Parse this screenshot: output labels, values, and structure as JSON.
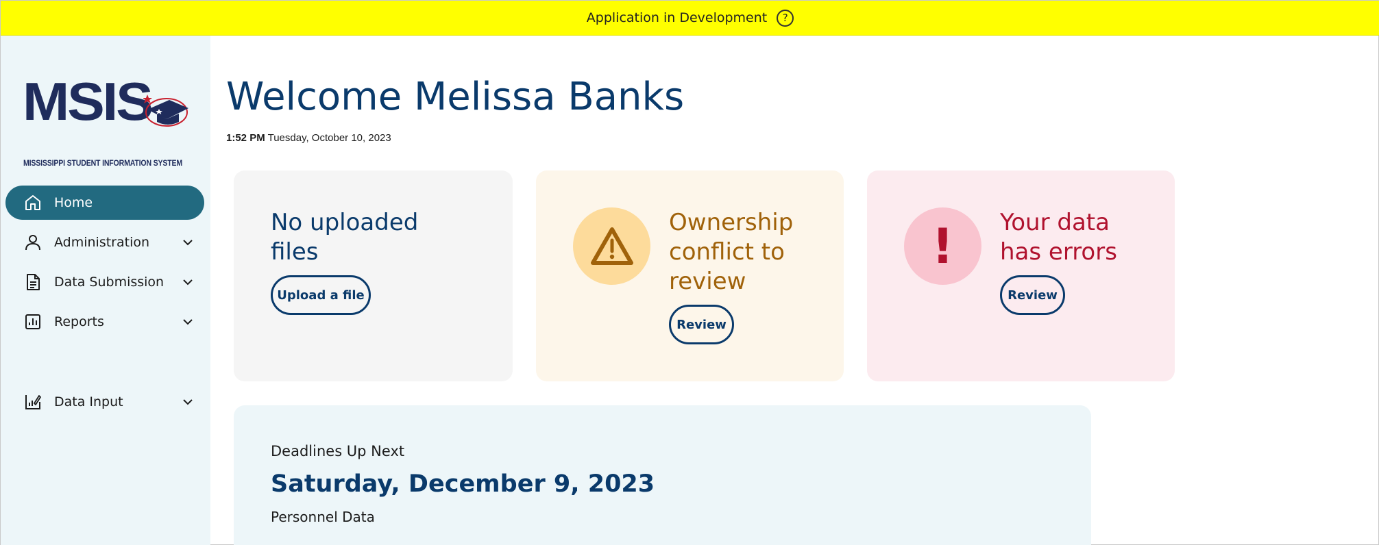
{
  "banner": {
    "text": "Application in Development",
    "help_icon": "help-circle-icon",
    "help_symbol": "?"
  },
  "logo": {
    "wordmark": "MSIS",
    "subtitle": "MISSISSIPPI STUDENT INFORMATION SYSTEM"
  },
  "sidebar": {
    "items": [
      {
        "label": "Home",
        "icon": "home-icon",
        "active": true
      },
      {
        "label": "Administration",
        "icon": "user-icon",
        "expandable": true
      },
      {
        "label": "Data Submission",
        "icon": "document-icon",
        "expandable": true
      },
      {
        "label": "Reports",
        "icon": "bar-chart-icon",
        "expandable": true
      },
      {
        "label": "Data Input",
        "icon": "data-input-icon",
        "expandable": true
      }
    ]
  },
  "main": {
    "welcome": "Welcome Melissa Banks",
    "time": "1:52 PM",
    "date": "Tuesday, October 10, 2023",
    "cards": [
      {
        "title_line1": "No uploaded",
        "title_line2": "files",
        "button": "Upload a file",
        "color": "#0a3a6b",
        "background": "#f5f5f5"
      },
      {
        "title_line1": "Ownership",
        "title_line2": "conflict to",
        "title_line3": "review",
        "button": "Review",
        "icon": "warning-icon",
        "color": "#a0620a",
        "background": "#fdf6ea",
        "icon_bg": "#fddb9b"
      },
      {
        "title_line1": "Your data",
        "title_line2": "has errors",
        "button": "Review",
        "icon": "exclamation-icon",
        "icon_symbol": "!",
        "color": "#b0122e",
        "background": "#fcebef",
        "icon_bg": "#f9c4cf"
      }
    ],
    "deadlines": {
      "label": "Deadlines Up Next",
      "date": "Saturday, December 9, 2023",
      "item": "Personnel Data"
    }
  },
  "colors": {
    "banner": "#ffff00",
    "sidebar_bg": "#edf6f9",
    "active_nav": "#226a80",
    "primary_text": "#0a3a6b"
  }
}
